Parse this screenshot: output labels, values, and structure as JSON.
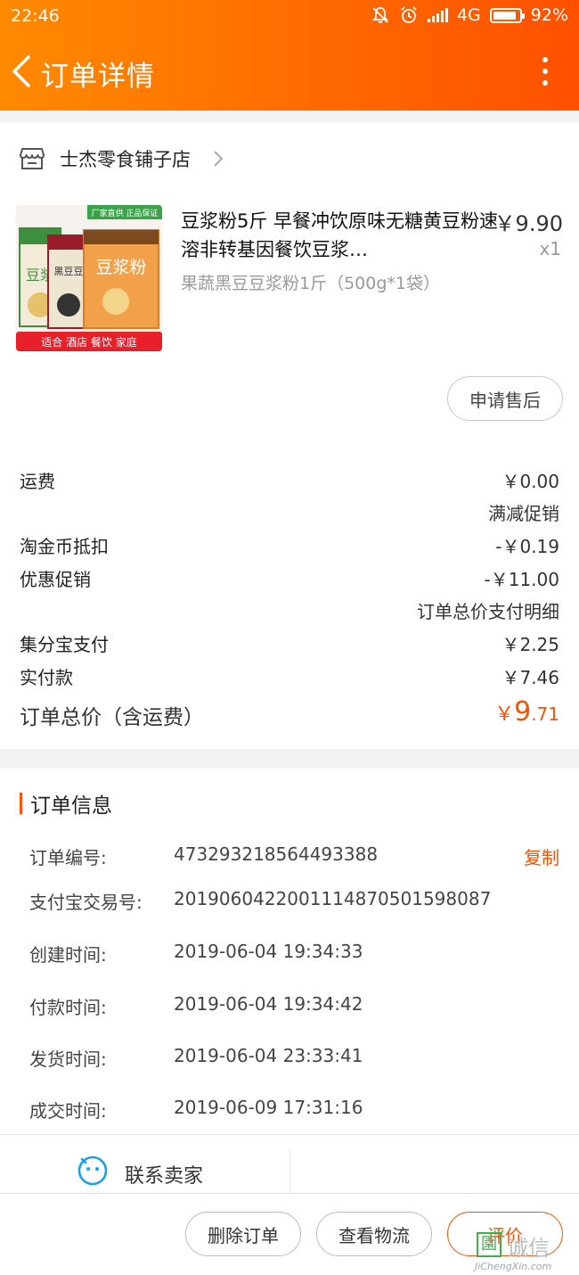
{
  "status_bar": {
    "time": "22:46",
    "network": "4G",
    "battery": "92%"
  },
  "nav": {
    "title": "订单详情"
  },
  "shop": {
    "name": "士杰零食铺子店"
  },
  "product": {
    "title": "豆浆粉5斤 早餐冲饮原味无糖黄豆粉速溶非转基因餐饮豆浆…",
    "price": "￥9.90",
    "qty": "x1",
    "sku": "果蔬黑豆豆浆粉1斤（500g*1袋）",
    "image_text": {
      "banner": "厂家直供 正品保证",
      "bag_left": "豆浆",
      "bag_mid": "黑豆豆",
      "bag_right": "豆浆粉",
      "footer": "适合 酒店 餐饮 家庭"
    }
  },
  "aftersale_button": "申请售后",
  "fees": [
    {
      "label": "运费",
      "value": "￥0.00"
    },
    {
      "label": "",
      "value": "满减促销"
    },
    {
      "label": "淘金币抵扣",
      "value": "-￥0.19"
    },
    {
      "label": "优惠促销",
      "value": "-￥11.00"
    },
    {
      "label": "",
      "value": "订单总价支付明细"
    },
    {
      "label": "集分宝支付",
      "value": "￥2.25"
    },
    {
      "label": "实付款",
      "value": "￥7.46"
    }
  ],
  "total": {
    "label": "订单总价（含运费）",
    "currency": "￥",
    "int": "9",
    "dec": ".71"
  },
  "order_info": {
    "heading": "订单信息",
    "copy_label": "复制",
    "rows": [
      {
        "label": "订单编号:",
        "value": "473293218564493388"
      },
      {
        "label": "支付宝交易号:",
        "value": "2019060422001114870501598087"
      },
      {
        "label": "创建时间:",
        "value": "2019-06-04 19:34:33"
      },
      {
        "label": "付款时间:",
        "value": "2019-06-04 19:34:42"
      },
      {
        "label": "发货时间:",
        "value": "2019-06-04 23:33:41"
      },
      {
        "label": "成交时间:",
        "value": "2019-06-09 17:31:16"
      }
    ]
  },
  "contact": {
    "label": "联系卖家"
  },
  "actions": {
    "delete": "删除订单",
    "logistics": "查看物流",
    "review": "评价"
  },
  "watermark": {
    "box": "園",
    "cn": "诚信",
    "en": "JiChengXin.com"
  }
}
